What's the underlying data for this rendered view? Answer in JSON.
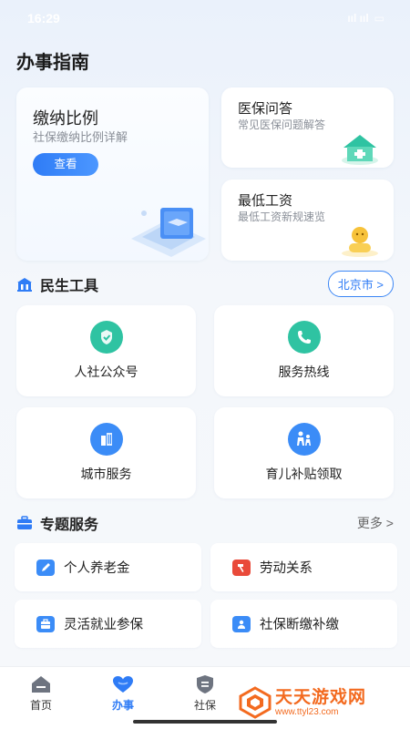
{
  "status_bar": {
    "time": "16:29",
    "signal": "ııl ııl",
    "battery": "▭"
  },
  "header": {
    "title": "办事指南"
  },
  "feature_cards": {
    "main": {
      "title": "缴纳比例",
      "subtitle": "社保缴纳比例详解",
      "button": "查看"
    },
    "medical": {
      "title": "医保问答",
      "subtitle": "常见医保问题解答"
    },
    "wage": {
      "title": "最低工资",
      "subtitle": "最低工资新规速览"
    }
  },
  "tools_section": {
    "title": "民生工具",
    "city_button": "北京市 >"
  },
  "tools": [
    {
      "label": "人社公众号",
      "icon": "shield-check-icon",
      "color": "#2fc3a2"
    },
    {
      "label": "服务热线",
      "icon": "phone-icon",
      "color": "#2fc3a2"
    },
    {
      "label": "城市服务",
      "icon": "building-icon",
      "color": "#3b8cf7"
    },
    {
      "label": "育儿补贴领取",
      "icon": "family-icon",
      "color": "#3b8cf7"
    }
  ],
  "topics_section": {
    "title": "专题服务",
    "more": "更多 >"
  },
  "topics": [
    {
      "label": "个人养老金",
      "icon": "pen-icon",
      "color": "#3b8cf7"
    },
    {
      "label": "劳动关系",
      "icon": "hammer-icon",
      "color": "#e94a3a"
    },
    {
      "label": "灵活就业参保",
      "icon": "briefcase-icon",
      "color": "#3b8cf7"
    },
    {
      "label": "社保断缴补缴",
      "icon": "user-card-icon",
      "color": "#3b8cf7"
    }
  ],
  "tabbar": {
    "tabs": [
      {
        "label": "首页",
        "icon": "home-icon"
      },
      {
        "label": "办事",
        "icon": "heart-icon"
      },
      {
        "label": "社保",
        "icon": "shield-icon"
      }
    ]
  },
  "watermark": {
    "title": "天天游戏网",
    "url": "www.ttyl23.com"
  }
}
